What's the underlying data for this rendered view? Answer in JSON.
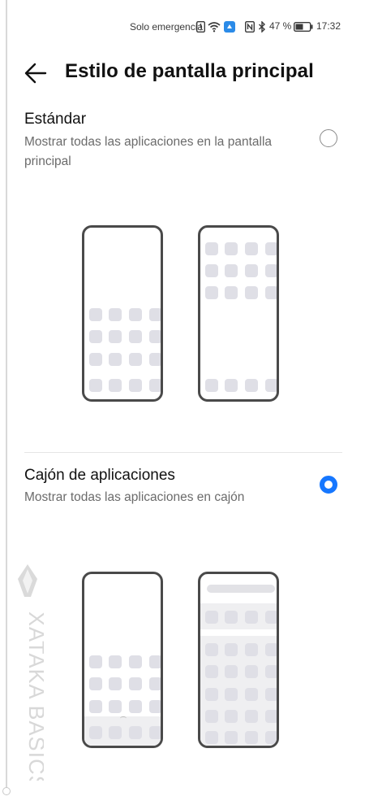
{
  "status_bar": {
    "network_text": "Solo emergencia",
    "battery_percent": "47 %",
    "time": "17:32",
    "icons": [
      "alert-icon",
      "wifi-icon",
      "app-notification-icon",
      "nfc-icon",
      "bluetooth-icon",
      "battery-icon"
    ]
  },
  "header": {
    "back_icon": "arrow-left-icon",
    "title": "Estilo de pantalla principal"
  },
  "options": [
    {
      "title": "Estándar",
      "description": "Mostrar todas las aplicaciones en la pantalla principal",
      "selected": false
    },
    {
      "title": "Cajón de aplicaciones",
      "description": "Mostrar todas las aplicaciones en cajón",
      "selected": true
    }
  ],
  "colors": {
    "accent": "#1677ff",
    "text_primary": "#111111",
    "text_secondary": "#6b6b6b"
  },
  "watermark": {
    "text": "XATAKA BASICS"
  }
}
